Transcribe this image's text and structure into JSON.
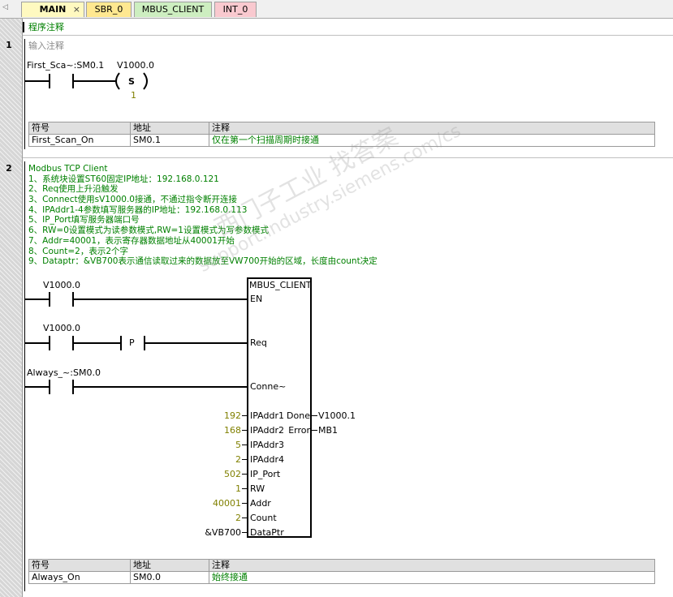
{
  "tabs": [
    {
      "label": "MAIN",
      "color": "#fff9c0",
      "active": true
    },
    {
      "label": "SBR_0",
      "color": "#ffe890"
    },
    {
      "label": "MBUS_CLIENT",
      "color": "#cdeec0"
    },
    {
      "label": "INT_0",
      "color": "#f9c9cf"
    }
  ],
  "program_comment": "程序注释",
  "networks": [
    {
      "number": "1",
      "comment": "输入注释",
      "contact_symbol": "First_Sca~:SM0.1",
      "coil_address": "V1000.0",
      "coil_type": "S",
      "coil_count": "1",
      "symbol_table": {
        "headers": [
          "符号",
          "地址",
          "注释"
        ],
        "rows": [
          [
            "First_Scan_On",
            "SM0.1",
            "仅在第一个扫描周期时接通"
          ]
        ]
      }
    },
    {
      "number": "2",
      "comment_lines": [
        "Modbus TCP Client",
        "1、系统块设置ST60固定IP地址：192.168.0.121",
        "2、Req使用上升沿触发",
        "3、Connect使用sV1000.0接通，不通过指令断开连接",
        "4、IPAddr1-4参数填写服务器的IP地址：192.168.0.113",
        "5、IP_Port填写服务器端口号",
        "6、RW=0设置模式为读参数模式,RW=1设置模式为写参数模式",
        "7、Addr=40001，表示寄存器数据地址从40001开始",
        "8、Count=2，表示2个字",
        "9、Dataptr：&VB700表示通信读取过来的数据放至VW700开始的区域，长度由count决定"
      ],
      "contacts": {
        "en": "V1000.0",
        "req": "V1000.0",
        "req_edge": "P",
        "connect": "Always_~:SM0.0"
      },
      "block": {
        "title": "MBUS_CLIENT",
        "pins_in": [
          "EN",
          "Req",
          "Conne~",
          "IPAddr1",
          "IPAddr2",
          "IPAddr3",
          "IPAddr4",
          "IP_Port",
          "RW",
          "Addr",
          "Count",
          "DataPtr"
        ],
        "pin_values": [
          "192",
          "168",
          "5",
          "2",
          "502",
          "1",
          "40001",
          "2",
          "&VB700"
        ],
        "pins_out": [
          "Done",
          "Error"
        ],
        "out_values": [
          "V1000.1",
          "MB1"
        ]
      },
      "symbol_table": {
        "headers": [
          "符号",
          "地址",
          "注释"
        ],
        "rows": [
          [
            "Always_On",
            "SM0.0",
            "始终接通"
          ]
        ]
      }
    }
  ],
  "watermark": {
    "line1": "西门子工业  找答案",
    "line2": "support.industry.siemens.com/cs"
  }
}
